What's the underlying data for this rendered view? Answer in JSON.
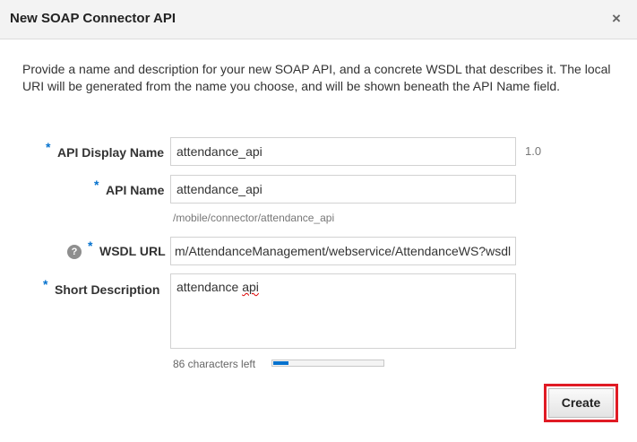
{
  "dialog": {
    "title": "New SOAP Connector API",
    "close_glyph": "×",
    "intro": "Provide a name and description for your new SOAP API, and a concrete WSDL that describes it. The local URI will be generated from the name you choose, and will be shown beneath the API Name field."
  },
  "form": {
    "required_mark": "*",
    "display_name": {
      "label": "API Display Name",
      "value": "attendance_api",
      "version": "1.0"
    },
    "api_name": {
      "label": "API Name",
      "value": "attendance_api",
      "uri": "/mobile/connector/attendance_api"
    },
    "wsdl_url": {
      "label": "WSDL URL",
      "value": "m/AttendanceManagement/webservice/AttendanceWS?wsdl",
      "help_glyph": "?"
    },
    "short_description": {
      "label": "Short Description",
      "value_word1": "attendance",
      "value_word2": "api",
      "chars_left": "86 characters left",
      "used_fraction": 0.14
    }
  },
  "actions": {
    "create_label": "Create",
    "highlight_color": "#e01b24"
  },
  "colors": {
    "accent": "#0572ce"
  }
}
